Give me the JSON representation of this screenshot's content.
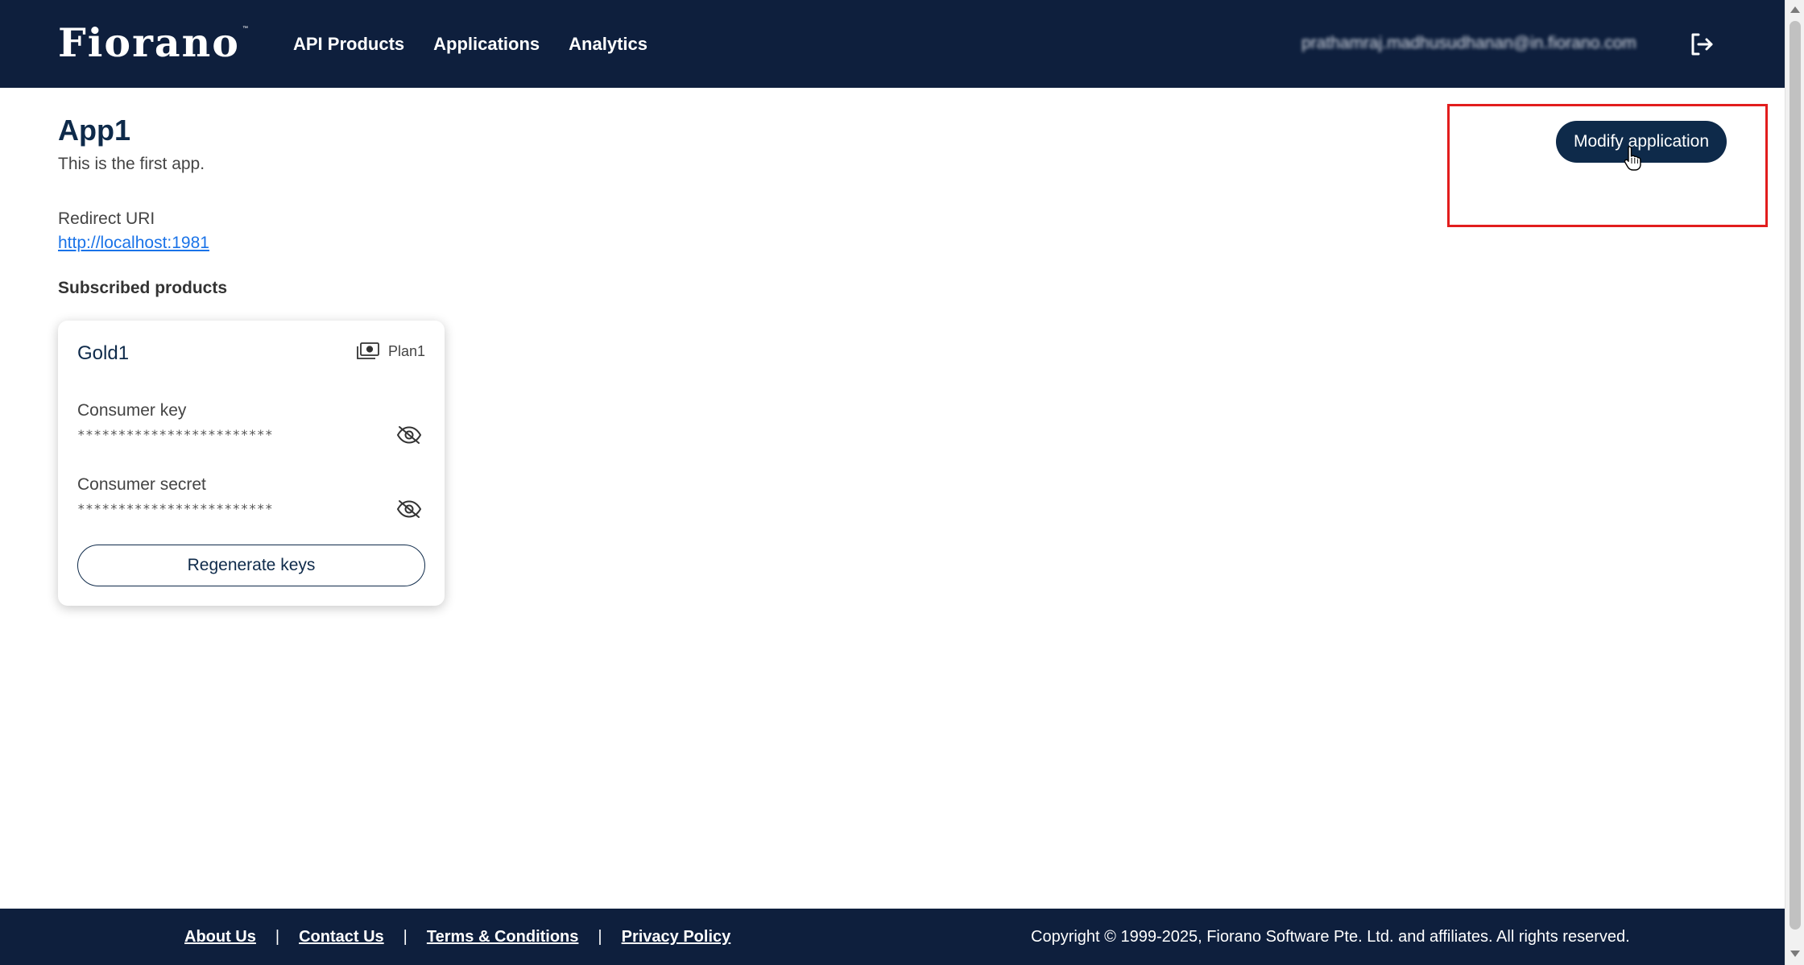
{
  "header": {
    "logo_text": "Fiorano",
    "logo_tm": "™",
    "nav": [
      {
        "label": "API Products"
      },
      {
        "label": "Applications"
      },
      {
        "label": "Analytics"
      }
    ],
    "user_email": "prathamraj.madhusudhanan@in.fiorano.com",
    "logout_icon": "logout-icon"
  },
  "app": {
    "title": "App1",
    "description": "This is the first app.",
    "redirect_label": "Redirect URI",
    "redirect_uri": "http://localhost:1981",
    "subscribed_heading": "Subscribed products",
    "modify_button": "Modify application"
  },
  "product_card": {
    "title": "Gold1",
    "plan_icon": "money-icon",
    "plan_label": "Plan1",
    "consumer_key_label": "Consumer key",
    "consumer_key_value": "************************",
    "consumer_secret_label": "Consumer secret",
    "consumer_secret_value": "************************",
    "visibility_icon": "eye-off-icon",
    "regenerate_button": "Regenerate keys"
  },
  "footer": {
    "links": [
      "About Us",
      "Contact Us",
      "Terms & Conditions",
      "Privacy Policy"
    ],
    "separator": "|",
    "copyright": "Copyright © 1999-2025, Fiorano Software Pte. Ltd. and affiliates. All rights reserved."
  },
  "colors": {
    "header_bg": "#0e1f3d",
    "primary": "#0e2a4a",
    "link": "#1a73e8",
    "highlight": "#e21d1d"
  }
}
